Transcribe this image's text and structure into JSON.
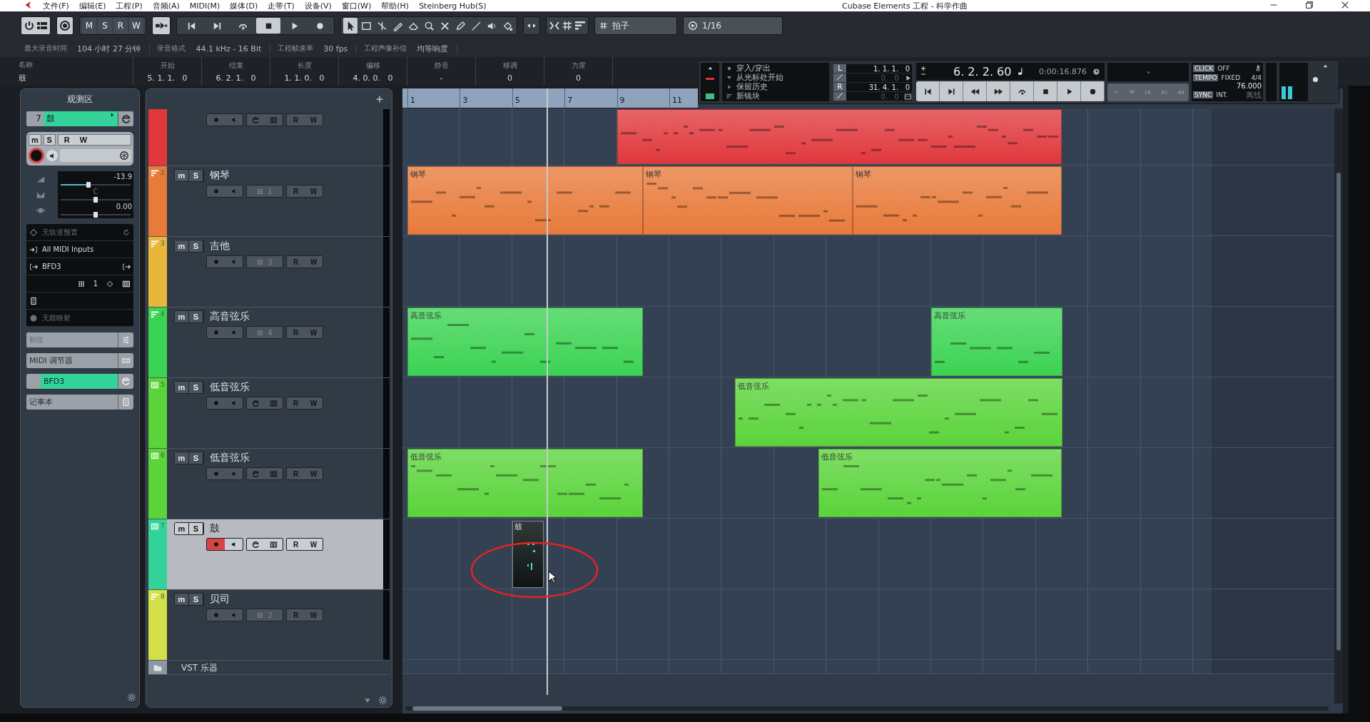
{
  "window": {
    "title": "Cubase Elements 工程 - 科学作曲"
  },
  "menu": [
    "文件(F)",
    "编辑(E)",
    "工程(P)",
    "音频(A)",
    "MIDI(M)",
    "媒体(D)",
    "走带(T)",
    "设备(V)",
    "窗口(W)",
    "帮助(H)",
    "Steinberg Hub(S)"
  ],
  "toolbar": {
    "automation_buttons": [
      "M",
      "S",
      "R",
      "W"
    ],
    "grid_type": "拍子",
    "quantize": "1/16"
  },
  "info_line": [
    {
      "label": "最大录音时间",
      "value": "104 小时 27 分钟"
    },
    {
      "label": "录音格式",
      "value": "44.1 kHz - 16 Bit"
    },
    {
      "label": "工程帧速率",
      "value": "30 fps"
    },
    {
      "label": "工程声像补偿",
      "value": "均等响度"
    }
  ],
  "info_bar": [
    {
      "label": "名称",
      "value": "鼓"
    },
    {
      "label": "开始",
      "value": "5. 1. 1.   0"
    },
    {
      "label": "结束",
      "value": "6. 2. 1.   0"
    },
    {
      "label": "长度",
      "value": "1. 1. 0.   0"
    },
    {
      "label": "偏移",
      "value": "4. 0. 0.   0"
    },
    {
      "label": "静音",
      "value": "-"
    },
    {
      "label": "移调",
      "value": "0"
    },
    {
      "label": "力度",
      "value": "0"
    }
  ],
  "transport": {
    "modes": [
      "穿入/穿出",
      "从光标处开始",
      "保留历史",
      "新镜块"
    ],
    "left_locator": {
      "label": "L",
      "value": "1. 1. 1.   0",
      "offset": "0.   0"
    },
    "right_locator": {
      "label": "R",
      "value": "31. 4. 1.   0",
      "offset": "0.   0"
    },
    "position": "6. 2. 2. 60",
    "time": "0:00:16.876",
    "click": {
      "label": "CLICK",
      "value": "OFF"
    },
    "tempo": {
      "label": "TEMPO",
      "value": "FIXED",
      "signature": "4/4",
      "bpm": "76.000"
    },
    "sync": {
      "label": "SYNC",
      "value": "INT.",
      "status": "离线"
    }
  },
  "inspector": {
    "title": "观测区",
    "track": {
      "number": "7",
      "name": "鼓"
    },
    "ms": [
      "m",
      "S"
    ],
    "rw": [
      "R",
      "W"
    ],
    "record": true,
    "volume": {
      "reading": "-13.9",
      "level": 0.4
    },
    "pan": {
      "reading": "C",
      "level": 0.5
    },
    "delay": {
      "reading": "0.00",
      "level": 0.5
    },
    "routing": [
      {
        "kind": "preset",
        "text": "无轨道预置",
        "disabled": true
      },
      {
        "kind": "input",
        "text": "All MIDI Inputs",
        "disabled": false
      },
      {
        "kind": "output",
        "text": "BFD3",
        "disabled": false
      },
      {
        "kind": "channel",
        "text": "1",
        "disabled": false
      },
      {
        "kind": "blank"
      },
      {
        "kind": "drum_map",
        "text": "无鼓映射",
        "disabled": true
      }
    ],
    "sections": [
      {
        "label": "和弦",
        "disabled": true,
        "highlighted": false
      },
      {
        "label": "MIDI 调节器",
        "disabled": false,
        "highlighted": false
      },
      {
        "label": "BFD3",
        "disabled": false,
        "highlighted": true
      },
      {
        "label": "记事本",
        "disabled": false,
        "highlighted": false
      }
    ]
  },
  "ruler": [
    "1",
    "3",
    "5",
    "7",
    "9",
    "11"
  ],
  "tracks": [
    {
      "kind": "instrument",
      "color": "#e0383c",
      "rw": [
        "R",
        "W"
      ],
      "selected": false,
      "record": false,
      "clips": [
        {
          "kind": "midi"
        }
      ]
    },
    {
      "kind": "midi",
      "color": "#e87a3a",
      "number": "2",
      "name": "钢琴",
      "ms": [
        "m",
        "S"
      ],
      "rw": [
        "R",
        "W"
      ],
      "channel": "1",
      "selected": false,
      "record": false,
      "clips": [
        {
          "kind": "midi",
          "label": "钢琴"
        },
        {
          "kind": "midi",
          "label": "钢琴"
        },
        {
          "kind": "midi",
          "label": "钢琴"
        }
      ]
    },
    {
      "kind": "midi",
      "color": "#e8b63a",
      "number": "3",
      "name": "吉他",
      "ms": [
        "m",
        "S"
      ],
      "rw": [
        "R",
        "W"
      ],
      "channel": "3",
      "selected": false,
      "record": false
    },
    {
      "kind": "midi",
      "color": "#3bd352",
      "number": "4",
      "name": "高音弦乐",
      "ms": [
        "m",
        "S"
      ],
      "rw": [
        "R",
        "W"
      ],
      "channel": "4",
      "selected": false,
      "record": false,
      "clips": [
        {
          "kind": "midi",
          "label": "高音弦乐"
        },
        {
          "kind": "midi",
          "label": "高音弦乐"
        }
      ]
    },
    {
      "kind": "instrument",
      "color": "#5ad43a",
      "number": "5",
      "name": "低音弦乐",
      "ms": [
        "m",
        "S"
      ],
      "rw": [
        "R",
        "W"
      ],
      "selected": false,
      "record": false,
      "clips": [
        {
          "kind": "midi",
          "label": "低音弦乐"
        }
      ]
    },
    {
      "kind": "instrument",
      "color": "#5ad43a",
      "number": "6",
      "name": "低音弦乐",
      "ms": [
        "m",
        "S"
      ],
      "rw": [
        "R",
        "W"
      ],
      "selected": false,
      "record": false,
      "clips": [
        {
          "kind": "midi",
          "label": "低音弦乐"
        },
        {
          "kind": "midi",
          "label": "低音弦乐"
        }
      ]
    },
    {
      "kind": "instrument",
      "color": "#33d39a",
      "number": "7",
      "name": "鼓",
      "ms": [
        "m",
        "S"
      ],
      "rw": [
        "R",
        "W"
      ],
      "selected": true,
      "record": true,
      "clips": [
        {
          "kind": "drum",
          "label": "鼓"
        }
      ]
    },
    {
      "kind": "midi",
      "color": "#d4e04a",
      "number": "8",
      "name": "贝司",
      "ms": [
        "m",
        "S"
      ],
      "rw": [
        "R",
        "W"
      ],
      "channel": "2",
      "selected": false,
      "record": false
    }
  ],
  "folder": {
    "name": "VST 乐器"
  }
}
